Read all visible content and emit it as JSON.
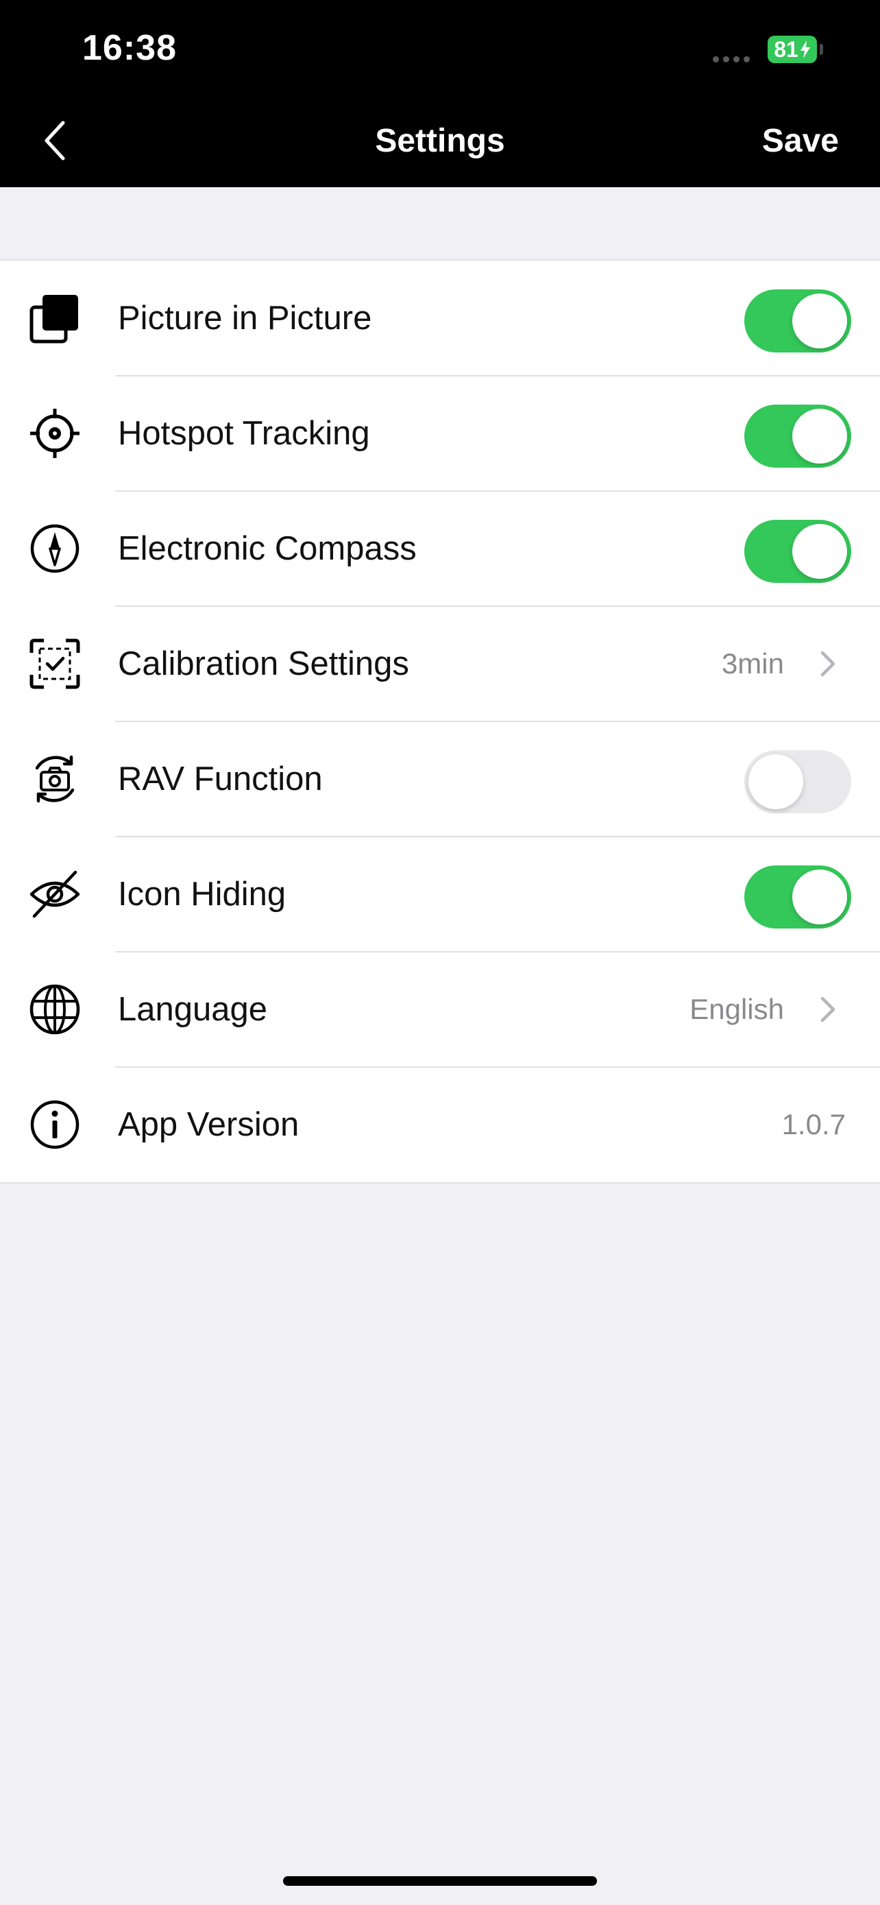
{
  "status_bar": {
    "time": "16:38",
    "battery_level": "81"
  },
  "nav": {
    "title": "Settings",
    "save_label": "Save",
    "back_icon": "chevron-left-icon"
  },
  "settings": [
    {
      "label": "Picture in Picture",
      "icon": "picture-in-picture-icon",
      "control": "toggle",
      "on": true
    },
    {
      "label": "Hotspot Tracking",
      "icon": "crosshair-icon",
      "control": "toggle",
      "on": true
    },
    {
      "label": "Electronic Compass",
      "icon": "compass-icon",
      "control": "toggle",
      "on": true
    },
    {
      "label": "Calibration Settings",
      "icon": "calibration-frame-icon",
      "control": "link",
      "value": "3min"
    },
    {
      "label": "RAV Function",
      "icon": "camera-rotate-icon",
      "control": "toggle",
      "on": false
    },
    {
      "label": "Icon Hiding",
      "icon": "eye-off-icon",
      "control": "toggle",
      "on": true
    },
    {
      "label": "Language",
      "icon": "globe-icon",
      "control": "link",
      "value": "English"
    },
    {
      "label": "App Version",
      "icon": "info-icon",
      "control": "text",
      "value": "1.0.7"
    }
  ],
  "colors": {
    "toggle_on": "#34c759",
    "toggle_off": "#e9e9eb",
    "header_bg": "#000000",
    "page_bg": "#f0f0f5"
  }
}
